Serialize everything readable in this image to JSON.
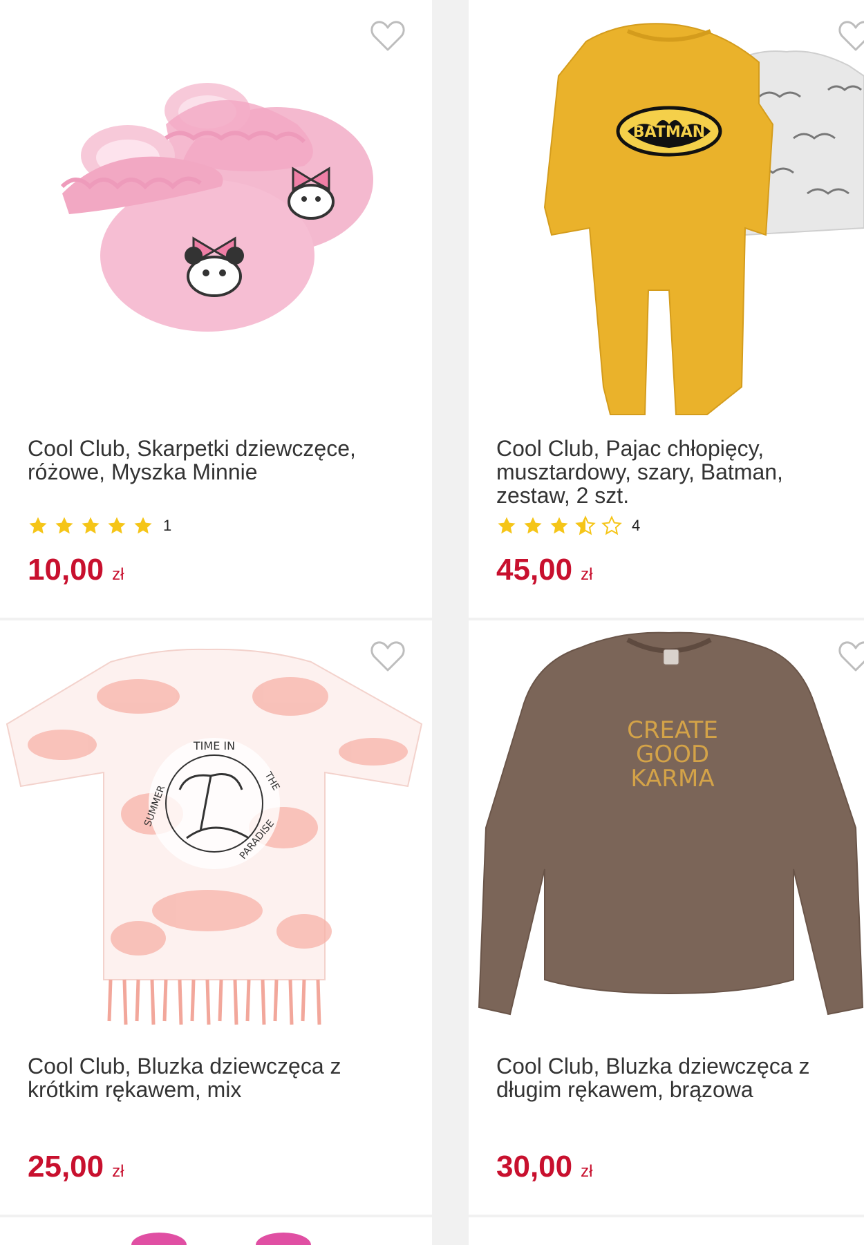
{
  "products": [
    {
      "title": "Cool Club, Skarpetki dziewczęce, różowe, Myszka Minnie",
      "rating_count": "1",
      "rating": 5,
      "price": "10,00",
      "currency": "zł"
    },
    {
      "title": "Cool Club, Pajac chłopięcy, musztardowy, szary, Batman, zestaw, 2 szt.",
      "rating_count": "4",
      "rating": 3.5,
      "price": "45,00",
      "currency": "zł"
    },
    {
      "title": "Cool Club, Bluzka dziewczęca z krótkim rękawem, mix",
      "price": "25,00",
      "currency": "zł"
    },
    {
      "title": "Cool Club, Bluzka dziewczęca z długim rękawem, brązowa",
      "price": "30,00",
      "currency": "zł"
    }
  ],
  "images": {
    "sweater_print": [
      "CREATE",
      "GOOD",
      "KARMA"
    ],
    "batman_logo": "BATMAN",
    "tshirt_print": {
      "top": "TIME IN",
      "left": "SUMMER",
      "right": "THE",
      "bottom": "PARADISE"
    }
  },
  "colors": {
    "price": "#c8102e",
    "star": "#f5c518",
    "text": "#333333",
    "heart": "#bdbdbd"
  }
}
